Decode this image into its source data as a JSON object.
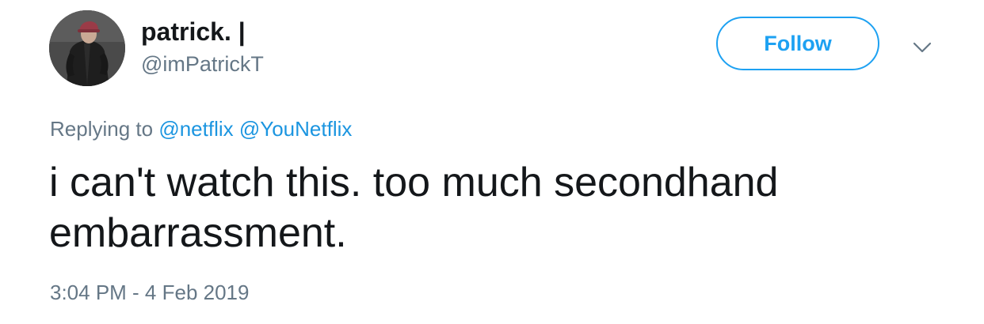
{
  "tweet": {
    "author": {
      "display_name": "patrick. |",
      "handle": "@imPatrickT"
    },
    "follow_label": "Follow",
    "menu_icon": "chevron-down-icon",
    "reply_context": {
      "prefix": "Replying to",
      "mentions": [
        "@netflix",
        "@YouNetflix"
      ]
    },
    "text": "i can't watch this. too much secondhand embarrassment.",
    "timestamp": "3:04 PM - 4 Feb 2019"
  },
  "colors": {
    "accent": "#1da1f2",
    "mention": "#1b95e0",
    "secondary_text": "#657786",
    "primary_text": "#14171a"
  }
}
